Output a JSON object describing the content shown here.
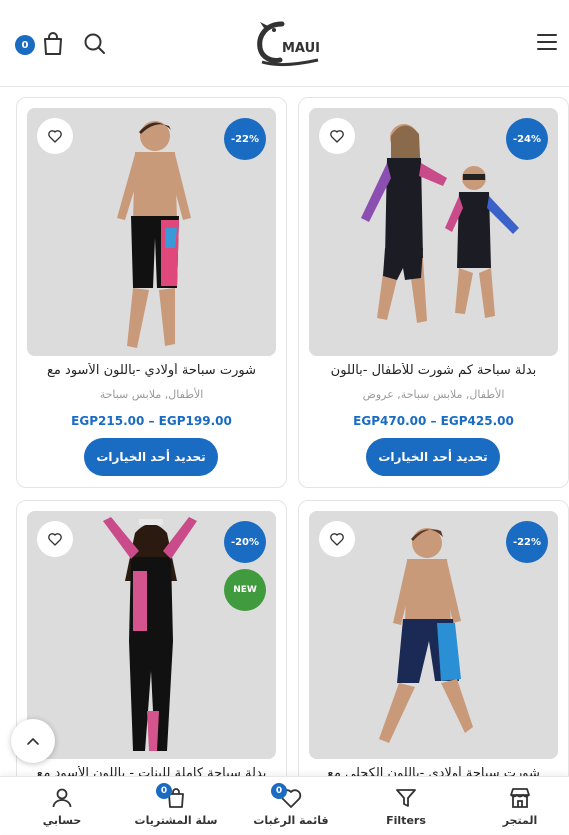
{
  "header": {
    "cart_count": "0",
    "logo_text": "MAUI"
  },
  "products": [
    {
      "title": "بدلة سباحة كم شورت للأطفال -باللون",
      "categories": "الأطفال, ملابس سباحة, عروض",
      "price": "EGP470.00 – EGP425.00",
      "discount": "-24%",
      "button": "تحديد أحد الخيارات"
    },
    {
      "title": "شورت سباحة أولادي -باللون الأسود مع",
      "categories": "الأطفال, ملابس سباحة",
      "price": "EGP215.00 – EGP199.00",
      "discount": "-22%",
      "button": "تحديد أحد الخيارات"
    },
    {
      "title": "شورت سباحة أولادي -باللون الكحلي مع",
      "discount": "-22%"
    },
    {
      "title": "بدلة سباحة كاملة للبنات - باللون الأسود مع",
      "discount": "-20%",
      "new_badge": "NEW"
    }
  ],
  "bottom_nav": [
    {
      "label": "المتجر",
      "icon": "store-icon"
    },
    {
      "label": "Filters",
      "icon": "filter-icon"
    },
    {
      "label": "قائمة الرغبات",
      "icon": "heart-icon",
      "badge": "0"
    },
    {
      "label": "سلة المشتريات",
      "icon": "cart-icon",
      "badge": "0"
    },
    {
      "label": "حسابي",
      "icon": "user-icon"
    }
  ],
  "colors": {
    "accent": "#1a6bc2",
    "new_badge": "#3f9b3e"
  }
}
